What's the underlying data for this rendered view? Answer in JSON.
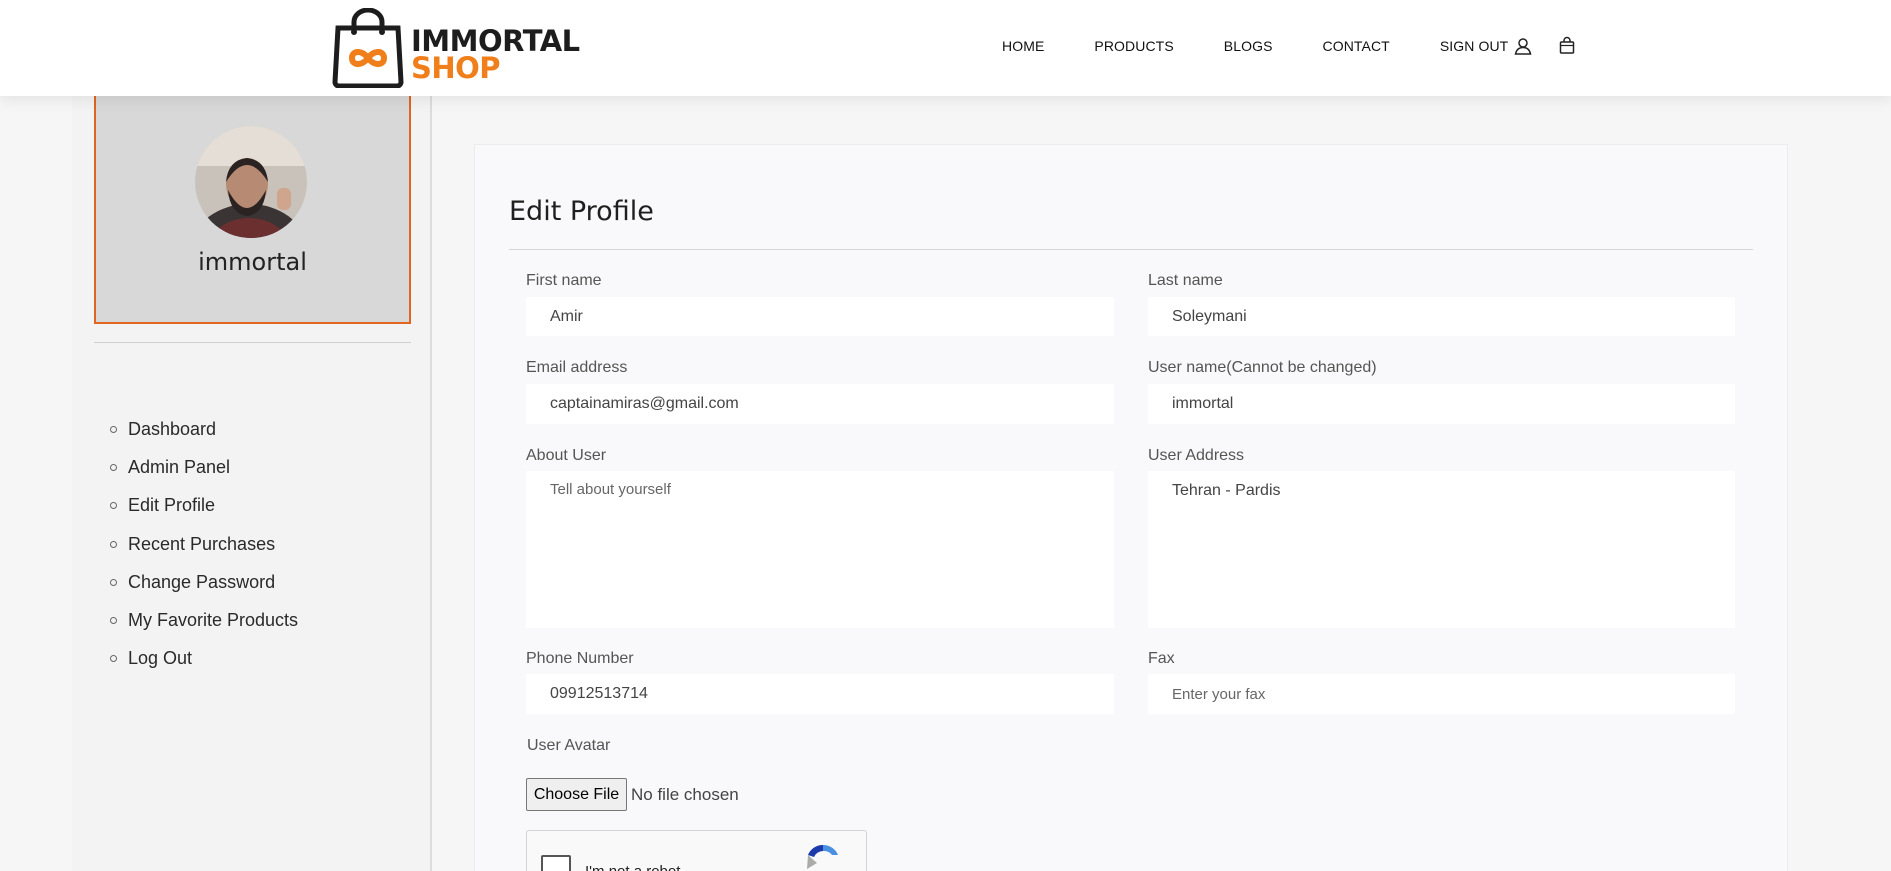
{
  "brand": {
    "name_line1": "IMMORTAL",
    "name_line2": "SHOP",
    "accent": "#f07f1b"
  },
  "nav": {
    "items": [
      "HOME",
      "PRODUCTS",
      "BLOGS",
      "CONTACT",
      "SIGN OUT"
    ],
    "icons": [
      "user-icon",
      "cart-icon"
    ]
  },
  "sidebar": {
    "username": "immortal",
    "items": [
      {
        "label": "Dashboard"
      },
      {
        "label": "Admin Panel"
      },
      {
        "label": "Edit Profile"
      },
      {
        "label": "Recent Purchases"
      },
      {
        "label": "Change Password"
      },
      {
        "label": "My Favorite Products"
      },
      {
        "label": "Log Out"
      }
    ]
  },
  "form": {
    "title": "Edit Profile",
    "first_name": {
      "label": "First name",
      "value": "Amir"
    },
    "last_name": {
      "label": "Last name",
      "value": "Soleymani"
    },
    "email": {
      "label": "Email address",
      "value": "captainamiras@gmail.com"
    },
    "user_name": {
      "label": "User name(Cannot be changed)",
      "value": "immortal"
    },
    "about": {
      "label": "About User",
      "placeholder": "Tell about yourself"
    },
    "address": {
      "label": "User Address",
      "value": "Tehran - Pardis"
    },
    "phone": {
      "label": "Phone Number",
      "value": "09912513714"
    },
    "fax": {
      "label": "Fax",
      "placeholder": "Enter your fax"
    },
    "avatar": {
      "label": "User Avatar",
      "button": "Choose File",
      "status": "No file chosen"
    },
    "captcha": {
      "label": "I'm not a robot"
    }
  }
}
